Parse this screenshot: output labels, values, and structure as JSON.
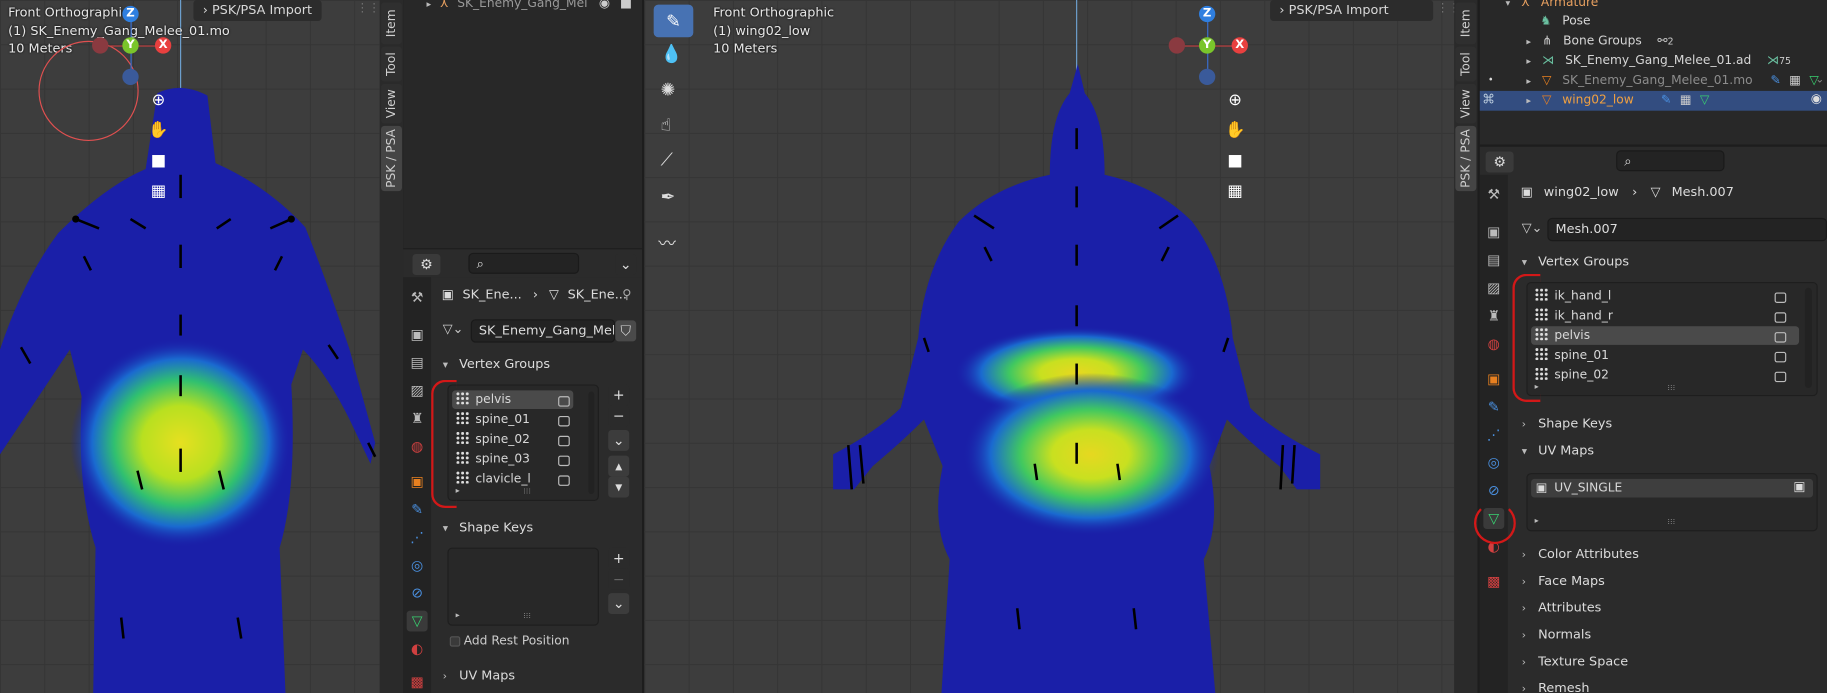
{
  "left_viewport": {
    "view_name": "Front Orthographic",
    "object_name": "(1) SK_Enemy_Gang_Melee_01.mo",
    "scale": "10 Meters",
    "header_button": "PSK/PSA Import",
    "gizmo": {
      "z": "Z",
      "y": "Y",
      "x": "X"
    }
  },
  "left_side_tabs": [
    "Item",
    "Tool",
    "View",
    "PSK / PSA"
  ],
  "left_outliner": {
    "row_label": "SK_Enemy_Gang_Mel"
  },
  "left_properties": {
    "search_placeholder": "",
    "breadcrumb": [
      "SK_Ene...",
      "SK_Ene..."
    ],
    "mesh_field": "SK_Enemy_Gang_Melee_...",
    "vertex_groups_title": "Vertex Groups",
    "vertex_groups": [
      "pelvis",
      "spine_01",
      "spine_02",
      "spine_03",
      "clavicle_l"
    ],
    "selected_vertex_group": "pelvis",
    "shape_keys_title": "Shape Keys",
    "add_rest_position": "Add Rest Position",
    "uv_maps_title": "UV Maps"
  },
  "center_viewport": {
    "view_name": "Front Orthographic",
    "object_name": "(1) wing02_low",
    "scale": "10 Meters",
    "header_button": "PSK/PSA Import",
    "gizmo": {
      "z": "Z",
      "y": "Y",
      "x": "X"
    }
  },
  "right_side_tabs": [
    "Item",
    "Tool",
    "View",
    "PSK / PSA"
  ],
  "outliner": {
    "rows": [
      {
        "label": "Armature",
        "indent": 0,
        "color": "#e8a060"
      },
      {
        "label": "Pose",
        "indent": 1,
        "color": "#d6d6d6"
      },
      {
        "label": "Bone Groups",
        "indent": 1,
        "color": "#d6d6d6",
        "badge": "2"
      },
      {
        "label": "SK_Enemy_Gang_Melee_01.ad",
        "indent": 1,
        "color": "#d6d6d6",
        "badge": "75"
      },
      {
        "label": "SK_Enemy_Gang_Melee_01.mo",
        "indent": 1,
        "color": "#8c8c8c"
      },
      {
        "label": "wing02_low",
        "indent": 1,
        "color": "#f0a040",
        "selected": true
      }
    ]
  },
  "properties": {
    "search_placeholder": "",
    "breadcrumb_object": "wing02_low",
    "breadcrumb_mesh": "Mesh.007",
    "mesh_field": "Mesh.007",
    "vertex_groups_title": "Vertex Groups",
    "vertex_groups": [
      "ik_hand_l",
      "ik_hand_r",
      "pelvis",
      "spine_01",
      "spine_02"
    ],
    "selected_vertex_group": "pelvis",
    "shape_keys_title": "Shape Keys",
    "uv_maps_title": "UV Maps",
    "uv_map_item": "UV_SINGLE",
    "collapsed_sections": [
      "Color Attributes",
      "Face Maps",
      "Attributes",
      "Normals",
      "Texture Space",
      "Remesh"
    ]
  },
  "colors": {
    "accent_blue": "#4772b3",
    "annotation_red": "#d31818",
    "gizmo_x": "#e8403f",
    "gizmo_y": "#7ac52b",
    "gizmo_z": "#2f7fe0",
    "mesh_blue": "#1a1fa8"
  }
}
